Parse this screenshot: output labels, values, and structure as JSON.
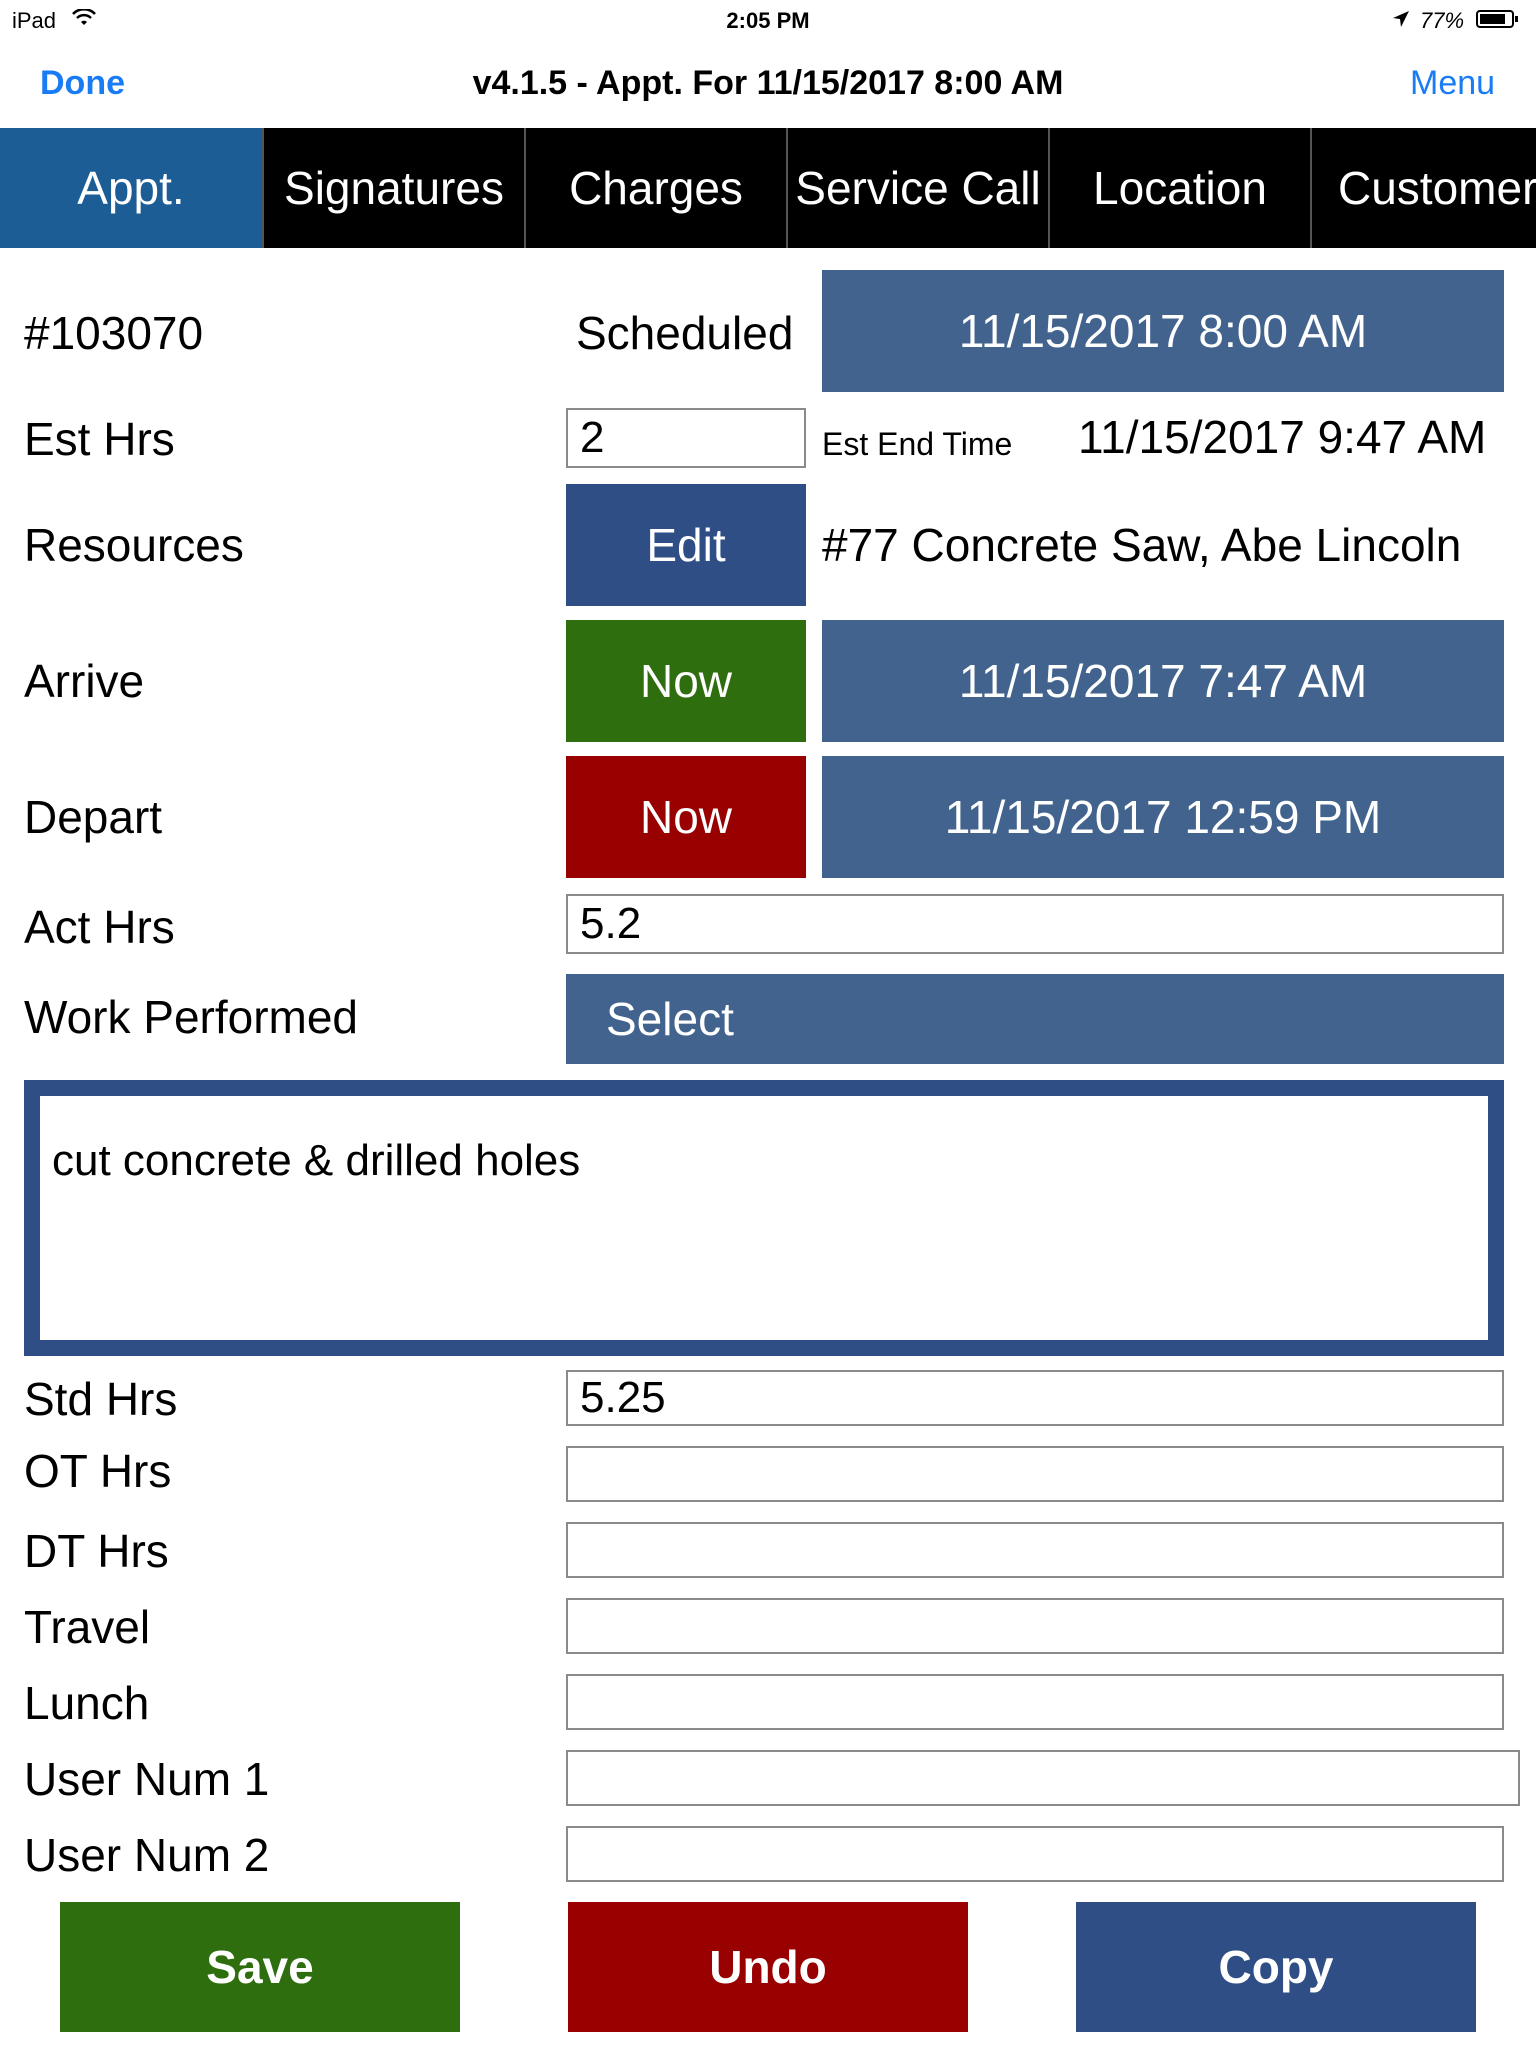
{
  "status": {
    "device": "iPad",
    "time": "2:05 PM",
    "battery": "77%",
    "icons": [
      "wifi-icon",
      "location-arrow-icon",
      "battery-icon"
    ]
  },
  "nav": {
    "done": "Done",
    "title": "v4.1.5 - Appt. For 11/15/2017 8:00 AM",
    "menu": "Menu"
  },
  "tabs": [
    "Appt.",
    "Signatures",
    "Charges",
    "Service Call",
    "Location",
    "Customer"
  ],
  "appt": {
    "number": "#103070",
    "scheduled_label": "Scheduled",
    "scheduled_value": "11/15/2017 8:00 AM",
    "est_hrs_label": "Est Hrs",
    "est_hrs_value": "2",
    "est_end_label": "Est End Time",
    "est_end_value": "11/15/2017 9:47 AM",
    "resources_label": "Resources",
    "edit_label": "Edit",
    "resources_value": "#77 Concrete Saw, Abe Lincoln",
    "arrive_label": "Arrive",
    "arrive_now": "Now",
    "arrive_value": "11/15/2017 7:47 AM",
    "depart_label": "Depart",
    "depart_now": "Now",
    "depart_value": "11/15/2017 12:59 PM",
    "act_hrs_label": "Act Hrs",
    "act_hrs_value": "5.2",
    "work_label": "Work Performed",
    "select_label": "Select",
    "notes": "cut concrete & drilled holes"
  },
  "hours": [
    {
      "label": "Std Hrs",
      "value": "5.25"
    },
    {
      "label": "OT Hrs",
      "value": ""
    },
    {
      "label": "DT Hrs",
      "value": ""
    },
    {
      "label": "Travel",
      "value": ""
    },
    {
      "label": "Lunch",
      "value": ""
    },
    {
      "label": "User Num 1",
      "value": ""
    },
    {
      "label": "User Num 2",
      "value": ""
    }
  ],
  "actions": {
    "save": "Save",
    "undo": "Undo",
    "copy": "Copy"
  },
  "colors": {
    "accent": "#1d5d95",
    "button_blue": "#42638d",
    "button_navy": "#2e4e85",
    "green": "#2f6e0e",
    "red": "#990000",
    "ios_link": "#1a7cf5"
  }
}
